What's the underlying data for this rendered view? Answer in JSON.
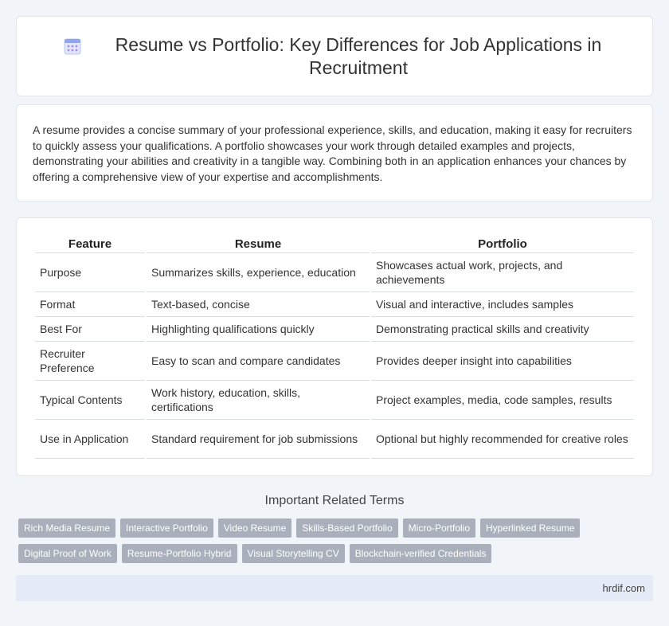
{
  "header": {
    "title": "Resume vs Portfolio: Key Differences for Job Applications in Recruitment",
    "icon": "calendar-icon"
  },
  "intro": {
    "text": "A resume provides a concise summary of your professional experience, skills, and education, making it easy for recruiters to quickly assess your qualifications. A portfolio showcases your work through detailed examples and projects, demonstrating your abilities and creativity in a tangible way. Combining both in an application enhances your chances by offering a comprehensive view of your expertise and accomplishments."
  },
  "table": {
    "headers": [
      "Feature",
      "Resume",
      "Portfolio"
    ],
    "rows": [
      [
        "Purpose",
        "Summarizes skills, experience, education",
        "Showcases actual work, projects, and achievements"
      ],
      [
        "Format",
        "Text-based, concise",
        "Visual and interactive, includes samples"
      ],
      [
        "Best For",
        "Highlighting qualifications quickly",
        "Demonstrating practical skills and creativity"
      ],
      [
        "Recruiter Preference",
        "Easy to scan and compare candidates",
        "Provides deeper insight into capabilities"
      ],
      [
        "Typical Contents",
        "Work history, education, skills, certifications",
        "Project examples, media, code samples, results"
      ],
      [
        "Use in Application",
        "Standard requirement for job submissions",
        "Optional but highly recommended for creative roles"
      ]
    ]
  },
  "related": {
    "title": "Important Related Terms",
    "row1": [
      "Rich Media Resume",
      "Interactive Portfolio",
      "Video Resume",
      "Skills-Based Portfolio",
      "Micro-Portfolio",
      "Hyperlinked Resume"
    ],
    "row2": [
      "Digital Proof of Work",
      "Resume-Portfolio Hybrid",
      "Visual Storytelling CV",
      "Blockchain-verified Credentials"
    ]
  },
  "footer": {
    "site": "hrdif.com"
  },
  "colors": {
    "background": "#f1f4f9",
    "tag": "#a9b0bc",
    "footer": "#e4ebf7"
  }
}
